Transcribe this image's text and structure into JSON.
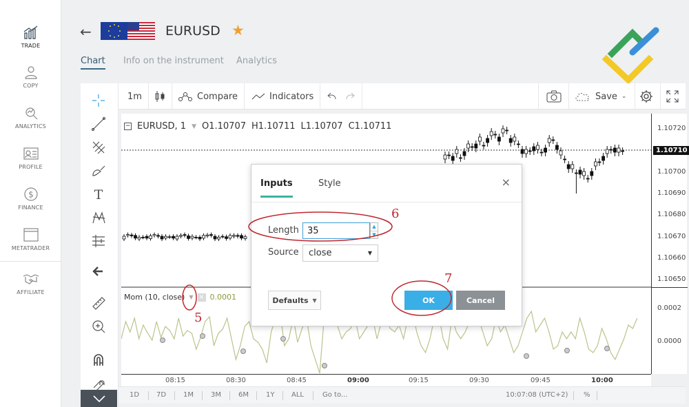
{
  "nav": [
    {
      "label": "TRADE",
      "icon": "chart-bars-icon",
      "active": true
    },
    {
      "label": "COPY",
      "icon": "user-copy-icon"
    },
    {
      "label": "ANALYTICS",
      "icon": "analytics-icon"
    },
    {
      "label": "PROFILE",
      "icon": "profile-card-icon"
    },
    {
      "label": "FINANCE",
      "icon": "dollar-coin-icon"
    },
    {
      "label": "METATRADER",
      "icon": "terminal-window-icon"
    },
    {
      "label": "AFFILIATE",
      "icon": "handshake-icon"
    }
  ],
  "header": {
    "symbol": "EURUSD",
    "tabs": [
      "Chart",
      "Info on the instrument",
      "Analytics"
    ],
    "active_tab": "Chart"
  },
  "toolbar": {
    "interval": "1m",
    "compare": "Compare",
    "indicators": "Indicators",
    "save": "Save"
  },
  "legend": {
    "symbol": "EURUSD, 1",
    "open_label": "O",
    "open": "1.10707",
    "high_label": "H",
    "high": "1.10711",
    "low_label": "L",
    "low": "1.10707",
    "close_label": "C",
    "close": "1.10711"
  },
  "indicator_legend": {
    "name": "Mom (10, close)",
    "value": "0.0001"
  },
  "price_scale": {
    "labels": [
      "1.10720",
      "1.10700",
      "1.10690",
      "1.10680",
      "1.10670",
      "1.10660",
      "1.10650"
    ],
    "current": "1.10710"
  },
  "mom_scale": [
    "0.0002",
    "0.0000"
  ],
  "time_labels": [
    "08:15",
    "08:30",
    "08:45",
    "09:00",
    "09:15",
    "09:30",
    "09:45",
    "10:00"
  ],
  "bottom_bar": {
    "ranges": [
      "1D",
      "7D",
      "1M",
      "3M",
      "6M",
      "1Y",
      "ALL"
    ],
    "goto": "Go to...",
    "clock": "10:07:08 (UTC+2)",
    "percent": "%"
  },
  "dialog": {
    "tabs": [
      "Inputs",
      "Style"
    ],
    "active_tab": "Inputs",
    "close": "×",
    "length_label": "Length",
    "length_value": "35",
    "source_label": "Source",
    "source_value": "close",
    "defaults": "Defaults",
    "ok": "OK",
    "cancel": "Cancel"
  },
  "annotations": [
    "5",
    "6",
    "7"
  ],
  "colors": {
    "accent": "#3aaee6",
    "tab_underline": "#3bb3a0",
    "annotation": "#c0272d",
    "star": "#f0a030",
    "mom_line": "#b8c48a"
  }
}
